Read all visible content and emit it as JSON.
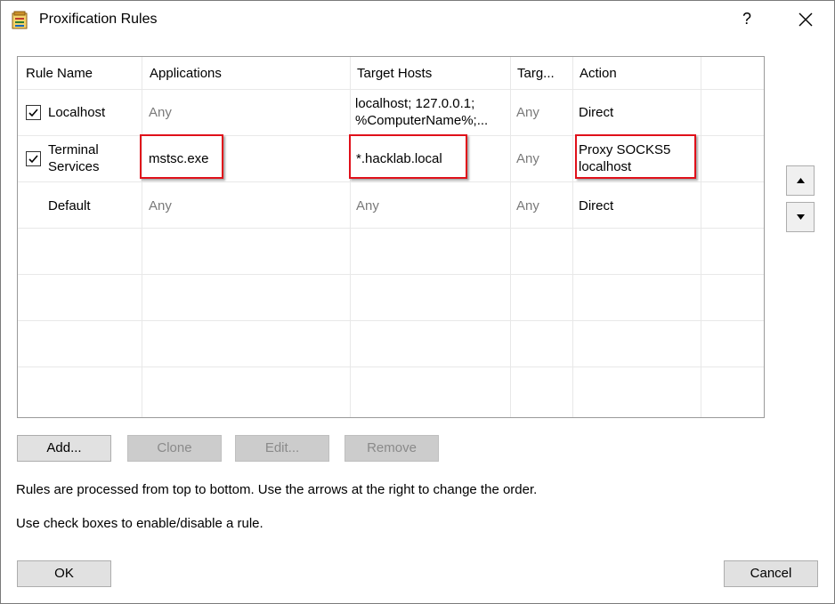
{
  "window": {
    "title": "Proxification Rules",
    "help_label": "?"
  },
  "table": {
    "headers": [
      "Rule Name",
      "Applications",
      "Target Hosts",
      "Targ...",
      "Action"
    ],
    "rows": [
      {
        "enabled": true,
        "name_line1": "Localhost",
        "name_line2": "",
        "applications": "Any",
        "hosts_line1": "localhost; 127.0.0.1;",
        "hosts_line2": "%ComputerName%;...",
        "ports": "Any",
        "action_line1": "Direct",
        "action_line2": ""
      },
      {
        "enabled": true,
        "name_line1": "Terminal",
        "name_line2": "Services",
        "applications": "mstsc.exe",
        "hosts_line1": "*.hacklab.local",
        "hosts_line2": "",
        "ports": "Any",
        "action_line1": "Proxy SOCKS5",
        "action_line2": "localhost"
      },
      {
        "enabled": null,
        "name_line1": "Default",
        "name_line2": "",
        "applications": "Any",
        "hosts_line1": "Any",
        "hosts_line2": "",
        "ports": "Any",
        "action_line1": "Direct",
        "action_line2": ""
      }
    ]
  },
  "buttons": {
    "add": "Add...",
    "clone": "Clone",
    "edit": "Edit...",
    "remove": "Remove",
    "ok": "OK",
    "cancel": "Cancel"
  },
  "info": {
    "line1": "Rules are processed from top to bottom. Use the arrows at the right to change the order.",
    "line2": "Use check boxes to enable/disable a rule."
  },
  "colors": {
    "highlight": "#e0101a",
    "disabled_button": "#cccccc",
    "muted_text": "#7a7a7a"
  },
  "icons": {
    "app": "proxifier-rules-icon",
    "close": "close-icon",
    "up": "arrow-up-icon",
    "down": "arrow-down-icon",
    "check": "checkmark-icon"
  }
}
